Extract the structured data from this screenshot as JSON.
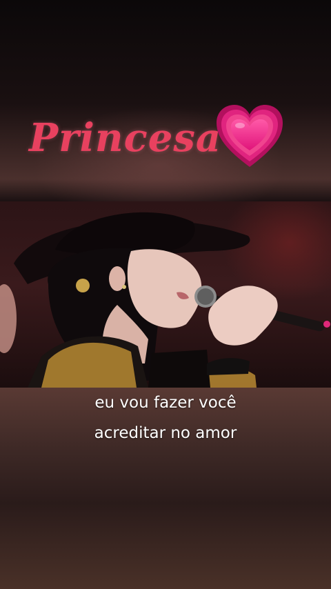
{
  "overlay": {
    "title": "Princesa",
    "title_color": "#e8415f",
    "emoji": "heart-icon"
  },
  "video": {
    "scene": "singer-performance"
  },
  "subtitles": {
    "line1": "eu vou fazer você",
    "line2": "acreditar no amor"
  }
}
